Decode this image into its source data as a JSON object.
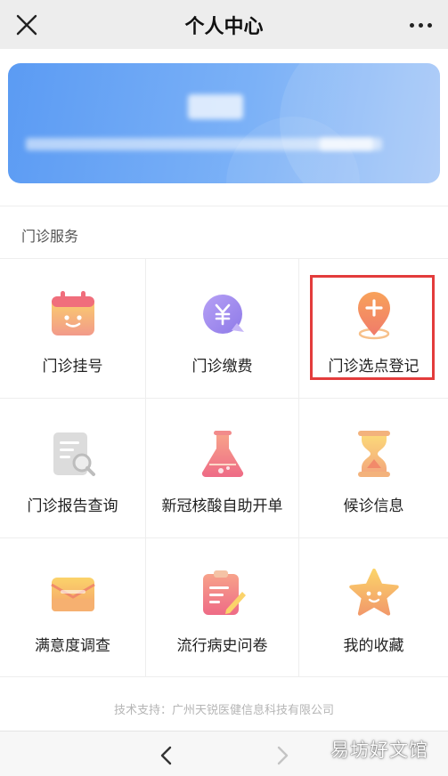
{
  "header": {
    "title": "个人中心",
    "close_icon": "close-icon",
    "more_icon": "more-icon"
  },
  "profile": {
    "name": "",
    "info": ""
  },
  "section": {
    "title": "门诊服务"
  },
  "services": [
    {
      "label": "门诊挂号",
      "icon": "calendar-icon"
    },
    {
      "label": "门诊缴费",
      "icon": "payment-icon"
    },
    {
      "label": "门诊选点登记",
      "icon": "location-plus-icon"
    },
    {
      "label": "门诊报告查询",
      "icon": "report-search-icon"
    },
    {
      "label": "新冠核酸自助开单",
      "icon": "flask-icon"
    },
    {
      "label": "候诊信息",
      "icon": "hourglass-icon"
    },
    {
      "label": "满意度调查",
      "icon": "envelope-icon"
    },
    {
      "label": "流行病史问卷",
      "icon": "clipboard-icon"
    },
    {
      "label": "我的收藏",
      "icon": "star-icon"
    }
  ],
  "footer": {
    "text": "技术支持：广州天锐医健信息科技有限公司"
  },
  "nav": {
    "back_icon": "back-icon",
    "forward_icon": "forward-icon"
  },
  "watermark": "易坊好文馆",
  "colors": {
    "card": "#5b9bf3",
    "highlight": "#e33c3c",
    "icon_gradient_start": "#fbd36a",
    "icon_gradient_end": "#f2748a"
  }
}
